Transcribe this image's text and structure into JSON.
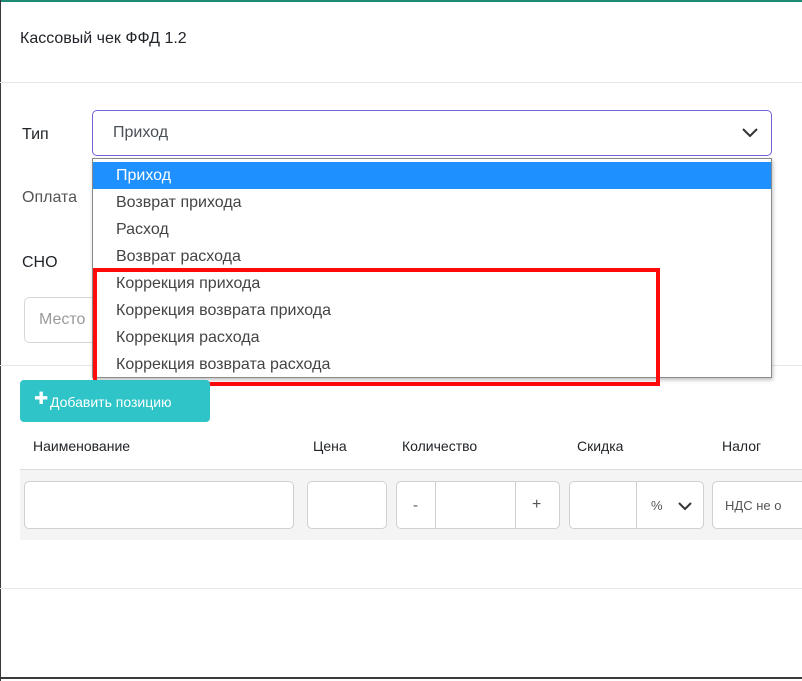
{
  "modal": {
    "title": "Кассовый чек ФФД 1.2"
  },
  "form": {
    "type_label": "Тип",
    "type_value": "Приход",
    "payment_label": "Оплата",
    "sno_label": "СНО",
    "location_placeholder": "Место"
  },
  "dropdown": {
    "options": [
      "Приход",
      "Возврат прихода",
      "Расход",
      "Возврат расхода",
      "Коррекция прихода",
      "Коррекция возврата прихода",
      "Коррекция расхода",
      "Коррекция возврата расхода"
    ],
    "selected_index": 0
  },
  "items": {
    "add_button_label": "Добавить позицию",
    "columns": [
      "Наименование",
      "Цена",
      "Количество",
      "Скидка",
      "Налог"
    ],
    "row": {
      "minus": "-",
      "plus": "+",
      "discount_unit": "%",
      "tax_value": "НДС не о"
    }
  },
  "colors": {
    "accent": "#1e8a76",
    "select_border": "#6e63d8",
    "selected_option": "#1e90ff",
    "add_button": "#2fc4c7",
    "highlight_box": "#ff0a0a"
  },
  "icons": [
    "chevron-down-icon",
    "plus-icon"
  ]
}
